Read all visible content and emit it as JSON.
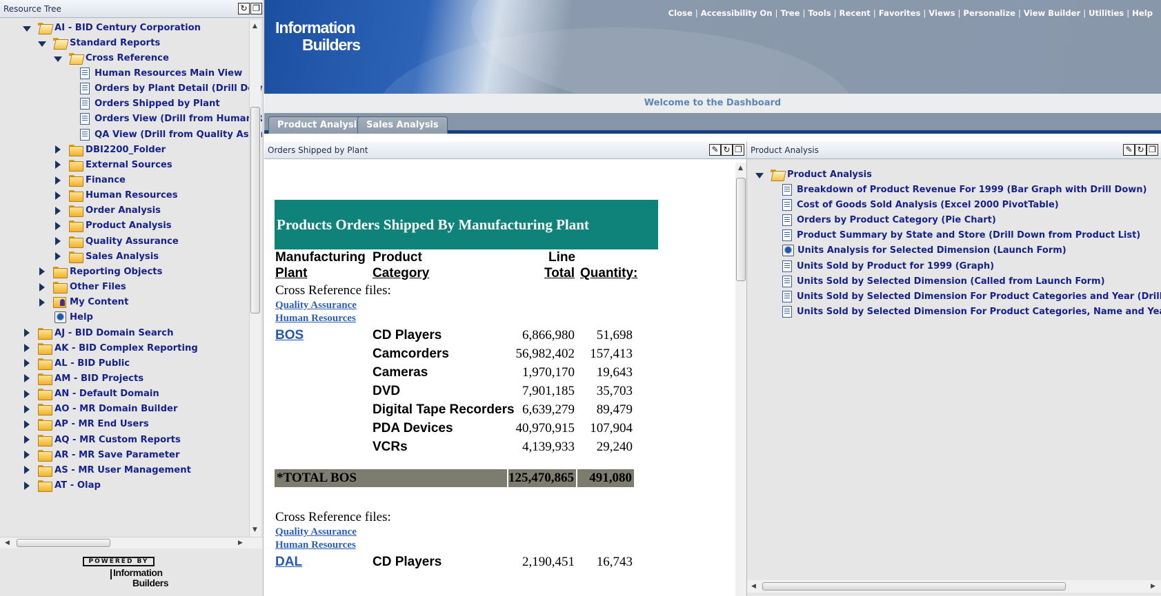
{
  "left_panel": {
    "title": "Resource Tree",
    "tree": [
      {
        "label": "AI - BID Century Corporation",
        "depth": 1,
        "arrow": "down",
        "icon": "folder-open"
      },
      {
        "label": "Standard Reports",
        "depth": 2,
        "arrow": "down",
        "icon": "folder-open"
      },
      {
        "label": "Cross Reference",
        "depth": 3,
        "arrow": "down",
        "icon": "folder-open"
      },
      {
        "label": "Human Resources Main View",
        "depth": 4,
        "arrow": "none",
        "icon": "document"
      },
      {
        "label": "Orders by Plant Detail (Drill Down",
        "depth": 4,
        "arrow": "none",
        "icon": "document"
      },
      {
        "label": "Orders Shipped by Plant",
        "depth": 4,
        "arrow": "none",
        "icon": "document"
      },
      {
        "label": "Orders View (Drill from Human Re",
        "depth": 4,
        "arrow": "none",
        "icon": "document"
      },
      {
        "label": "QA View (Drill from Quality Assur",
        "depth": 4,
        "arrow": "none",
        "icon": "document"
      },
      {
        "label": "DBI2200_Folder",
        "depth": 3,
        "arrow": "right",
        "icon": "folder"
      },
      {
        "label": "External Sources",
        "depth": 3,
        "arrow": "right",
        "icon": "folder"
      },
      {
        "label": "Finance",
        "depth": 3,
        "arrow": "right",
        "icon": "folder"
      },
      {
        "label": "Human Resources",
        "depth": 3,
        "arrow": "right",
        "icon": "folder"
      },
      {
        "label": "Order Analysis",
        "depth": 3,
        "arrow": "right",
        "icon": "folder"
      },
      {
        "label": "Product Analysis",
        "depth": 3,
        "arrow": "right",
        "icon": "folder"
      },
      {
        "label": "Quality Assurance",
        "depth": 3,
        "arrow": "right",
        "icon": "folder"
      },
      {
        "label": "Sales Analysis",
        "depth": 3,
        "arrow": "right",
        "icon": "folder"
      },
      {
        "label": "Reporting Objects",
        "depth": 2,
        "arrow": "right",
        "icon": "folder"
      },
      {
        "label": "Other Files",
        "depth": 2,
        "arrow": "right",
        "icon": "folder"
      },
      {
        "label": "My Content",
        "depth": 2,
        "arrow": "right",
        "icon": "person-folder"
      },
      {
        "label": "Help",
        "depth": 2,
        "arrow": "none",
        "icon": "help"
      },
      {
        "label": "AJ - BID Domain Search",
        "depth": 1,
        "arrow": "right",
        "icon": "folder"
      },
      {
        "label": "AK - BID Complex Reporting",
        "depth": 1,
        "arrow": "right",
        "icon": "folder"
      },
      {
        "label": "AL - BID Public",
        "depth": 1,
        "arrow": "right",
        "icon": "folder"
      },
      {
        "label": "AM - BID Projects",
        "depth": 1,
        "arrow": "right",
        "icon": "folder"
      },
      {
        "label": "AN - Default Domain",
        "depth": 1,
        "arrow": "right",
        "icon": "folder"
      },
      {
        "label": "AO - MR Domain Builder",
        "depth": 1,
        "arrow": "right",
        "icon": "folder"
      },
      {
        "label": "AP - MR End Users",
        "depth": 1,
        "arrow": "right",
        "icon": "folder"
      },
      {
        "label": "AQ - MR Custom Reports",
        "depth": 1,
        "arrow": "right",
        "icon": "folder"
      },
      {
        "label": "AR - MR Save Parameter",
        "depth": 1,
        "arrow": "right",
        "icon": "folder"
      },
      {
        "label": "AS - MR User Management",
        "depth": 1,
        "arrow": "right",
        "icon": "folder"
      },
      {
        "label": "AT - Olap",
        "depth": 1,
        "arrow": "right",
        "icon": "folder"
      }
    ],
    "powered_by_top": "POWERED BY",
    "powered_by_name_1": "Information",
    "powered_by_name_2": "Builders"
  },
  "banner": {
    "brand_line1": "Information",
    "brand_line2": "Builders",
    "links": [
      "Close",
      "Accessibility On",
      "Tree",
      "Tools",
      "Recent",
      "Favorites",
      "Views",
      "Personalize",
      "View Builder",
      "Utilities",
      "Help"
    ]
  },
  "welcome": "Welcome to the Dashboard",
  "tabs": [
    "Product Analysis",
    "Sales Analysis"
  ],
  "mid_panel": {
    "title": "Orders Shipped by Plant",
    "report": {
      "title": "Products Orders Shipped By Manufacturing Plant",
      "headers": {
        "plant_1": "Manufacturing",
        "plant_2": "Plant",
        "cat_1": "Product",
        "cat_2": "Category",
        "lt_1": "Line",
        "lt_2": "Total",
        "qty": "Quantity:"
      },
      "xref_label": "Cross Reference files:",
      "xref_links": [
        "Quality Assurance",
        "Human Resources"
      ],
      "plants": [
        {
          "name": "BOS",
          "rows": [
            {
              "category": "CD Players",
              "line_total": "6,866,980",
              "quantity": "51,698"
            },
            {
              "category": "Camcorders",
              "line_total": "56,982,402",
              "quantity": "157,413"
            },
            {
              "category": "Cameras",
              "line_total": "1,970,170",
              "quantity": "19,643"
            },
            {
              "category": "DVD",
              "line_total": "7,901,185",
              "quantity": "35,703"
            },
            {
              "category": "Digital Tape Recorders",
              "line_total": "6,639,279",
              "quantity": "89,479"
            },
            {
              "category": "PDA Devices",
              "line_total": "40,970,915",
              "quantity": "107,904"
            },
            {
              "category": "VCRs",
              "line_total": "4,139,933",
              "quantity": "29,240"
            }
          ],
          "total_label": "*TOTAL BOS",
          "total_line": "125,470,865",
          "total_qty": "491,080"
        },
        {
          "name": "DAL",
          "rows": [
            {
              "category": "CD Players",
              "line_total": "2,190,451",
              "quantity": "16,743"
            }
          ]
        }
      ]
    }
  },
  "right_panel": {
    "title": "Product Analysis",
    "folder": "Product Analysis",
    "items": [
      {
        "label": "Breakdown of Product Revenue For 1999 (Bar Graph with Drill Down)",
        "icon": "document"
      },
      {
        "label": "Cost of Goods Sold Analysis (Excel 2000 PivotTable)",
        "icon": "document"
      },
      {
        "label": "Orders by Product Category (Pie Chart)",
        "icon": "document"
      },
      {
        "label": "Product Summary by State and Store (Drill Down from Product List)",
        "icon": "document"
      },
      {
        "label": "Units Analysis for Selected Dimension (Launch Form)",
        "icon": "launch-form"
      },
      {
        "label": "Units Sold by Product for 1999 (Graph)",
        "icon": "document"
      },
      {
        "label": "Units Sold by Selected Dimension (Called from Launch Form)",
        "icon": "document"
      },
      {
        "label": "Units Sold by Selected Dimension For Product Categories and Year (Drill Down)",
        "icon": "document"
      },
      {
        "label": "Units Sold by Selected Dimension For Product Categories, Name and Year (Drill Do",
        "icon": "document"
      }
    ]
  }
}
